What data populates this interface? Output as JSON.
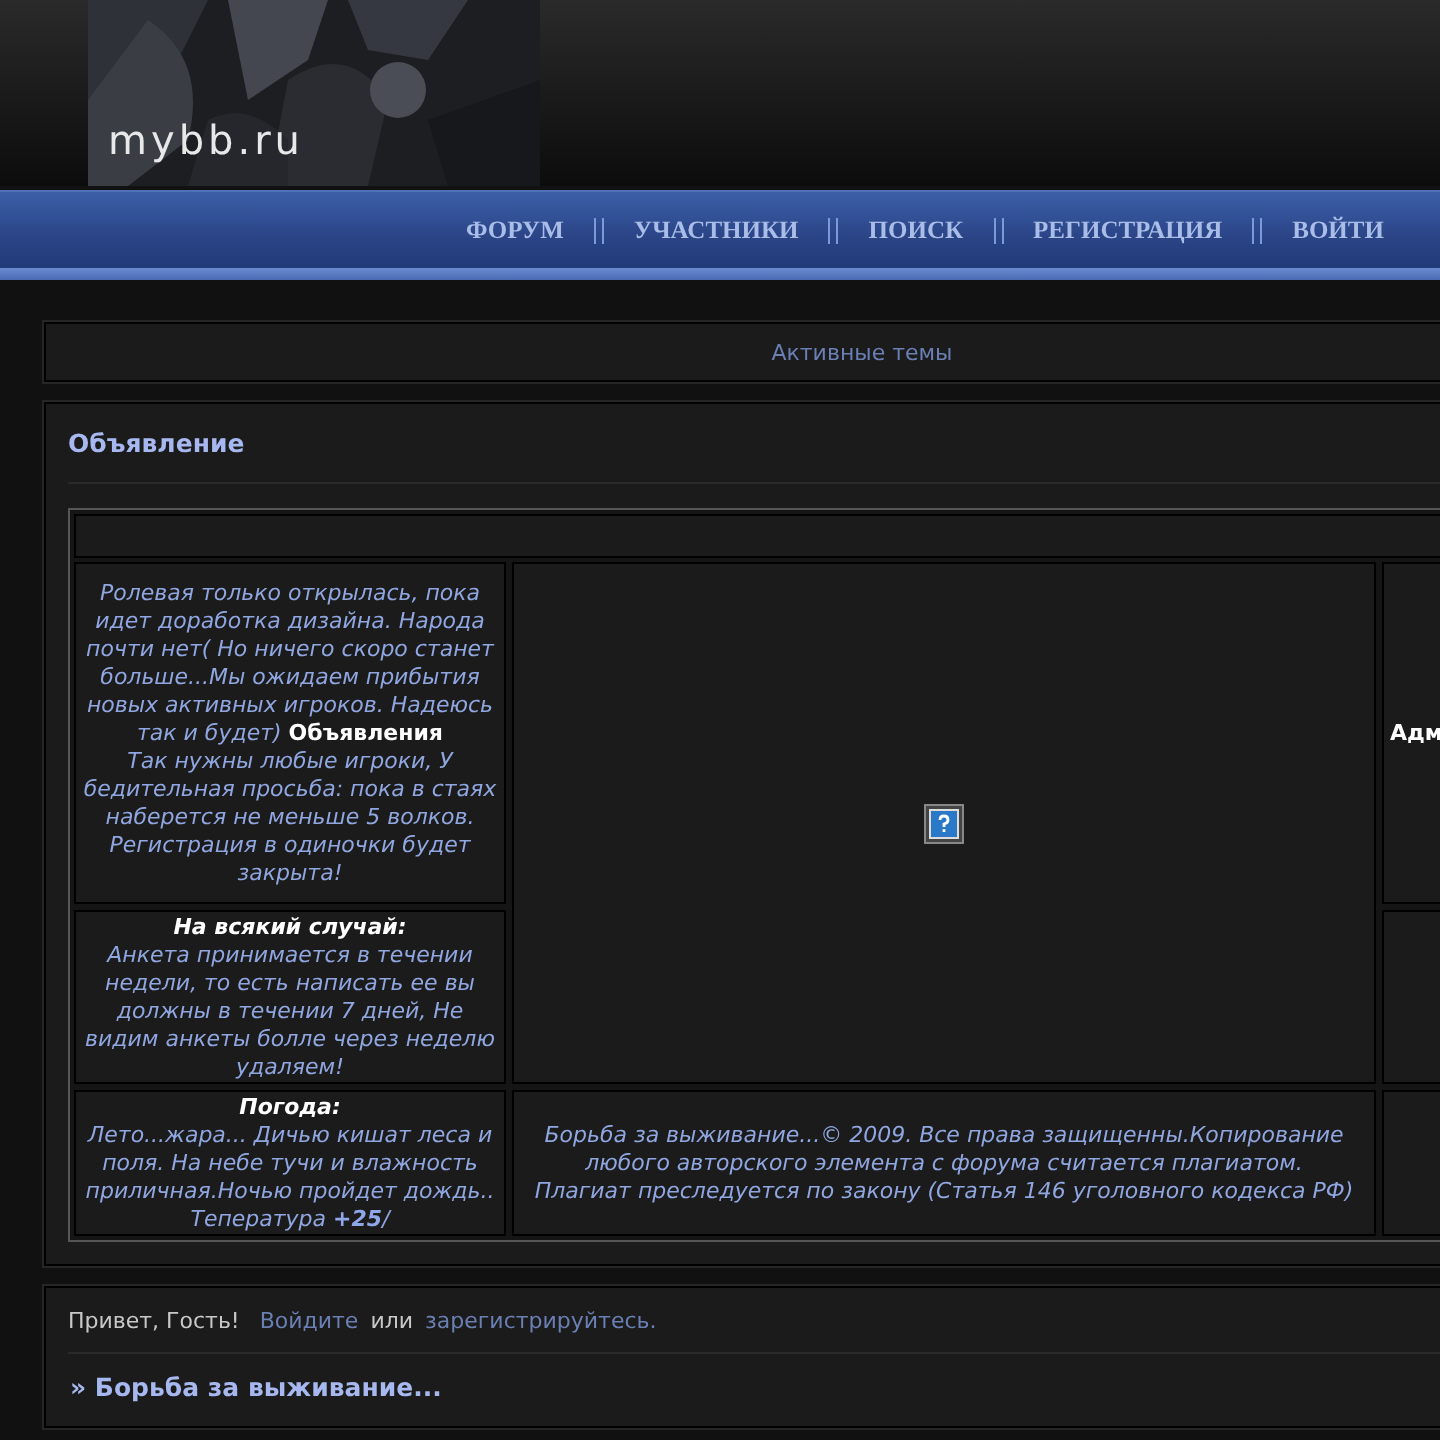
{
  "header": {
    "logo": "mybb.ru"
  },
  "nav": [
    {
      "label": "ФОРУМ"
    },
    {
      "label": "УЧАСТНИКИ"
    },
    {
      "label": "ПОИСК"
    },
    {
      "label": "РЕГИСТРАЦИЯ"
    },
    {
      "label": "ВОЙТИ"
    }
  ],
  "active_topics": "Активные темы",
  "announcement": {
    "title": "Объявление",
    "side_cells": [
      {
        "text": "Ролевая только открылась, пока идет доработка дизайна. Народа почти нет( Но ничего скоро станет больше...Мы ожидаем прибытия новых активных игроков. Надеюсь так и будет) **Объявления**\nТак нужны любые игроки, У бедительная просьба: пока в стаях наберется не меньше 5 волков. Регистрация в одиночки будет закрыта!",
        "kind": "notice"
      },
      {
        "heading": "На всякий случай:",
        "text": "Анкета принимается в течении недели, то есть написать ее вы должны в течении 7 дней, Не видим анкеты болле через неделю удаляем!",
        "kind": "notice"
      },
      {
        "heading": "Погода:",
        "text": "Лето...жара... Дичью кишат леса и поля. На небе тучи и влажность приличная.Ночью пройдет дождь.. Тепература **+25**/",
        "kind": "weather"
      }
    ],
    "image": {
      "broken": true
    },
    "footer_text": "Борьба за выживание...© 2009. Все права защищенны.Копирование любого авторского элемента с форума считается плагиатом. Плагиат преследуется по закону (Статья 146 уголовного кодекса РФ)",
    "column_3": [
      "Адм"
    ]
  },
  "welcome": {
    "greeting": "Привет, Гость!",
    "login_link": "Войдите",
    "joiner": "или",
    "register_link": "зарегистрируйтесь."
  },
  "forum_title": "» Борьба за выживание..."
}
